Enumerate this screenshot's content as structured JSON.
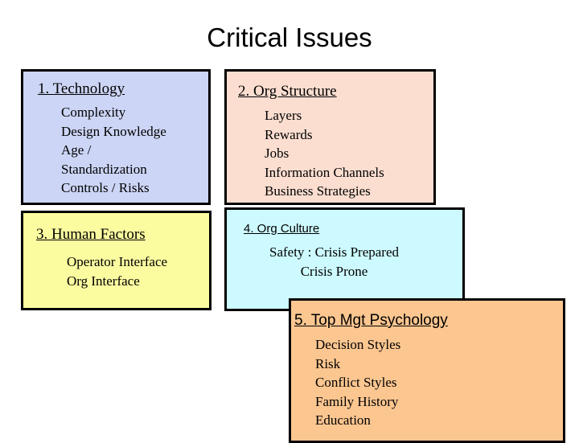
{
  "slide": {
    "title": "Critical Issues",
    "background_color": "#ffffff"
  },
  "boxes": [
    {
      "id": "technology",
      "number": "1.",
      "title": "1. Technology",
      "fill_color": "#ccd5f5",
      "border_color": "#000000",
      "items": [
        "Complexity",
        "Design Knowledge",
        "Age /",
        "Standardization",
        "Controls / Risks"
      ]
    },
    {
      "id": "org-structure",
      "number": "2.",
      "title": "2. Org Structure",
      "fill_color": "#fbded0",
      "border_color": "#000000",
      "items": [
        "Layers",
        "Rewards",
        "Jobs",
        "Information Channels",
        "Business Strategies"
      ]
    },
    {
      "id": "human-factors",
      "number": "3.",
      "title": "3. Human Factors",
      "fill_color": "#fbfba0",
      "border_color": "#000000",
      "items": [
        "Operator Interface",
        "Org Interface"
      ]
    },
    {
      "id": "org-culture",
      "number": "4.",
      "title": "4. Org Culture",
      "fill_color": "#cdfaff",
      "border_color": "#000000",
      "items": [
        "Safety : Crisis Prepared",
        "Crisis Prone"
      ]
    },
    {
      "id": "top-mgt",
      "number": "5.",
      "title": "5. Top Mgt Psychology",
      "fill_color": "#fcc690",
      "border_color": "#000000",
      "items": [
        "Decision Styles",
        "Risk",
        "Conflict Styles",
        "Family History",
        "Education"
      ]
    }
  ]
}
